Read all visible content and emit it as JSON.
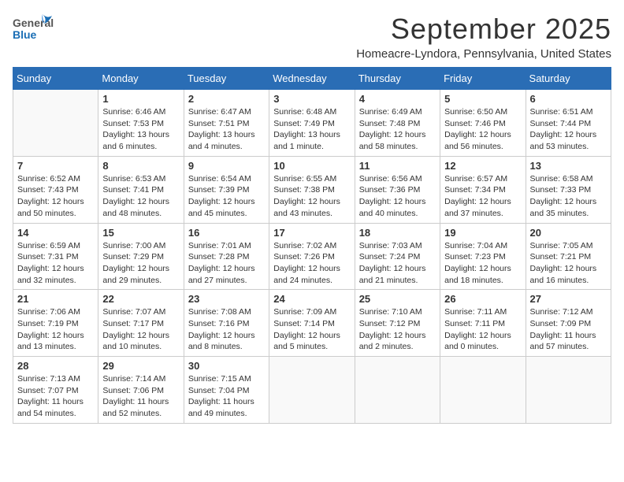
{
  "logo": {
    "text_general": "General",
    "text_blue": "Blue"
  },
  "title": "September 2025",
  "subtitle": "Homeacre-Lyndora, Pennsylvania, United States",
  "weekdays": [
    "Sunday",
    "Monday",
    "Tuesday",
    "Wednesday",
    "Thursday",
    "Friday",
    "Saturday"
  ],
  "weeks": [
    [
      {
        "day": "",
        "info": ""
      },
      {
        "day": "1",
        "info": "Sunrise: 6:46 AM\nSunset: 7:53 PM\nDaylight: 13 hours\nand 6 minutes."
      },
      {
        "day": "2",
        "info": "Sunrise: 6:47 AM\nSunset: 7:51 PM\nDaylight: 13 hours\nand 4 minutes."
      },
      {
        "day": "3",
        "info": "Sunrise: 6:48 AM\nSunset: 7:49 PM\nDaylight: 13 hours\nand 1 minute."
      },
      {
        "day": "4",
        "info": "Sunrise: 6:49 AM\nSunset: 7:48 PM\nDaylight: 12 hours\nand 58 minutes."
      },
      {
        "day": "5",
        "info": "Sunrise: 6:50 AM\nSunset: 7:46 PM\nDaylight: 12 hours\nand 56 minutes."
      },
      {
        "day": "6",
        "info": "Sunrise: 6:51 AM\nSunset: 7:44 PM\nDaylight: 12 hours\nand 53 minutes."
      }
    ],
    [
      {
        "day": "7",
        "info": "Sunrise: 6:52 AM\nSunset: 7:43 PM\nDaylight: 12 hours\nand 50 minutes."
      },
      {
        "day": "8",
        "info": "Sunrise: 6:53 AM\nSunset: 7:41 PM\nDaylight: 12 hours\nand 48 minutes."
      },
      {
        "day": "9",
        "info": "Sunrise: 6:54 AM\nSunset: 7:39 PM\nDaylight: 12 hours\nand 45 minutes."
      },
      {
        "day": "10",
        "info": "Sunrise: 6:55 AM\nSunset: 7:38 PM\nDaylight: 12 hours\nand 43 minutes."
      },
      {
        "day": "11",
        "info": "Sunrise: 6:56 AM\nSunset: 7:36 PM\nDaylight: 12 hours\nand 40 minutes."
      },
      {
        "day": "12",
        "info": "Sunrise: 6:57 AM\nSunset: 7:34 PM\nDaylight: 12 hours\nand 37 minutes."
      },
      {
        "day": "13",
        "info": "Sunrise: 6:58 AM\nSunset: 7:33 PM\nDaylight: 12 hours\nand 35 minutes."
      }
    ],
    [
      {
        "day": "14",
        "info": "Sunrise: 6:59 AM\nSunset: 7:31 PM\nDaylight: 12 hours\nand 32 minutes."
      },
      {
        "day": "15",
        "info": "Sunrise: 7:00 AM\nSunset: 7:29 PM\nDaylight: 12 hours\nand 29 minutes."
      },
      {
        "day": "16",
        "info": "Sunrise: 7:01 AM\nSunset: 7:28 PM\nDaylight: 12 hours\nand 27 minutes."
      },
      {
        "day": "17",
        "info": "Sunrise: 7:02 AM\nSunset: 7:26 PM\nDaylight: 12 hours\nand 24 minutes."
      },
      {
        "day": "18",
        "info": "Sunrise: 7:03 AM\nSunset: 7:24 PM\nDaylight: 12 hours\nand 21 minutes."
      },
      {
        "day": "19",
        "info": "Sunrise: 7:04 AM\nSunset: 7:23 PM\nDaylight: 12 hours\nand 18 minutes."
      },
      {
        "day": "20",
        "info": "Sunrise: 7:05 AM\nSunset: 7:21 PM\nDaylight: 12 hours\nand 16 minutes."
      }
    ],
    [
      {
        "day": "21",
        "info": "Sunrise: 7:06 AM\nSunset: 7:19 PM\nDaylight: 12 hours\nand 13 minutes."
      },
      {
        "day": "22",
        "info": "Sunrise: 7:07 AM\nSunset: 7:17 PM\nDaylight: 12 hours\nand 10 minutes."
      },
      {
        "day": "23",
        "info": "Sunrise: 7:08 AM\nSunset: 7:16 PM\nDaylight: 12 hours\nand 8 minutes."
      },
      {
        "day": "24",
        "info": "Sunrise: 7:09 AM\nSunset: 7:14 PM\nDaylight: 12 hours\nand 5 minutes."
      },
      {
        "day": "25",
        "info": "Sunrise: 7:10 AM\nSunset: 7:12 PM\nDaylight: 12 hours\nand 2 minutes."
      },
      {
        "day": "26",
        "info": "Sunrise: 7:11 AM\nSunset: 7:11 PM\nDaylight: 12 hours\nand 0 minutes."
      },
      {
        "day": "27",
        "info": "Sunrise: 7:12 AM\nSunset: 7:09 PM\nDaylight: 11 hours\nand 57 minutes."
      }
    ],
    [
      {
        "day": "28",
        "info": "Sunrise: 7:13 AM\nSunset: 7:07 PM\nDaylight: 11 hours\nand 54 minutes."
      },
      {
        "day": "29",
        "info": "Sunrise: 7:14 AM\nSunset: 7:06 PM\nDaylight: 11 hours\nand 52 minutes."
      },
      {
        "day": "30",
        "info": "Sunrise: 7:15 AM\nSunset: 7:04 PM\nDaylight: 11 hours\nand 49 minutes."
      },
      {
        "day": "",
        "info": ""
      },
      {
        "day": "",
        "info": ""
      },
      {
        "day": "",
        "info": ""
      },
      {
        "day": "",
        "info": ""
      }
    ]
  ]
}
